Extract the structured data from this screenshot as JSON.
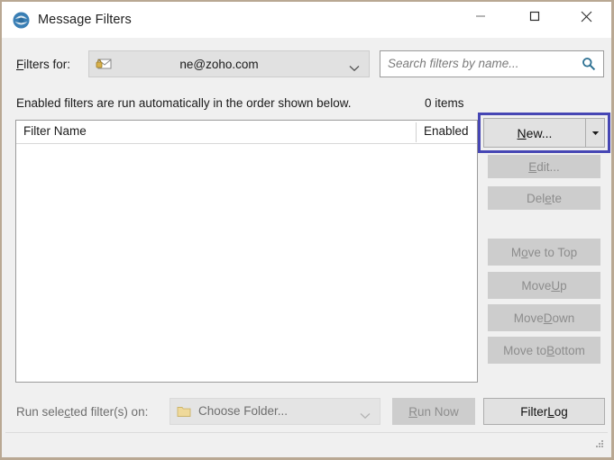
{
  "window": {
    "title": "Message Filters",
    "app_icon": "thunderbird-icon",
    "accent_focus_color": "#4646b4",
    "controls": {
      "minimize": "minimize-icon",
      "maximize": "maximize-icon",
      "close": "close-icon"
    }
  },
  "filters_for": {
    "label": "Filters for:",
    "label_accel": "F",
    "account_icon": "secure-mail-icon",
    "value": "ne@zoho.com",
    "arrow": "chevron-down-icon"
  },
  "search": {
    "placeholder": "Search filters by name...",
    "value": "",
    "icon": "search-icon"
  },
  "info": {
    "text": "Enabled filters are run automatically in the order shown below.",
    "items_count": "0 items"
  },
  "list": {
    "columns": [
      "Filter Name",
      "Enabled"
    ],
    "rows": []
  },
  "side_buttons": [
    {
      "name": "new",
      "label": "New...",
      "accel": "N",
      "enabled": true,
      "split": true,
      "focused": true
    },
    {
      "name": "edit",
      "label": "Edit...",
      "accel": "E",
      "enabled": false,
      "split": false,
      "focused": false
    },
    {
      "name": "delete",
      "label": "Delete",
      "accel": "e",
      "enabled": false,
      "split": false,
      "focused": false
    },
    {
      "name": "move-to-top",
      "label": "Move to Top",
      "accel": "o",
      "enabled": false,
      "split": false,
      "focused": false
    },
    {
      "name": "move-up",
      "label": "Move Up",
      "accel": "U",
      "enabled": false,
      "split": false,
      "focused": false
    },
    {
      "name": "move-down",
      "label": "Move Down",
      "accel": "D",
      "enabled": false,
      "split": false,
      "focused": false
    },
    {
      "name": "move-to-bottom",
      "label": "Move to Bottom",
      "accel": "B",
      "enabled": false,
      "split": false,
      "focused": false
    }
  ],
  "bottom": {
    "run_label": "Run selected filter(s) on:",
    "folder_icon": "folder-icon",
    "folder_value": "Choose Folder...",
    "folder_arrow": "chevron-down-icon",
    "run_now_label": "Run Now",
    "filter_log_label": "Filter Log"
  },
  "labels": {
    "new_a": "N",
    "new_b": "ew...",
    "edit_a": "E",
    "edit_b": "dit...",
    "del_a": "Del",
    "del_b": "e",
    "del_c": "te",
    "top_a": "M",
    "top_b": "o",
    "top_c": "ve to Top",
    "up_a": "Move ",
    "up_b": "U",
    "up_c": "p",
    "down_a": "Move ",
    "down_b": "D",
    "down_c": "own",
    "bottom_a": "Move to ",
    "bottom_b": "B",
    "bottom_c": "ottom",
    "runlbl_a": "Run sele",
    "runlbl_b": "c",
    "runlbl_c": "ted filter(s) on:",
    "runnow_a": "R",
    "runnow_b": "un Now",
    "flog_a": "Filter ",
    "flog_b": "L",
    "flog_c": "og",
    "filtersfor_a": "F",
    "filtersfor_b": "ilters for:"
  }
}
